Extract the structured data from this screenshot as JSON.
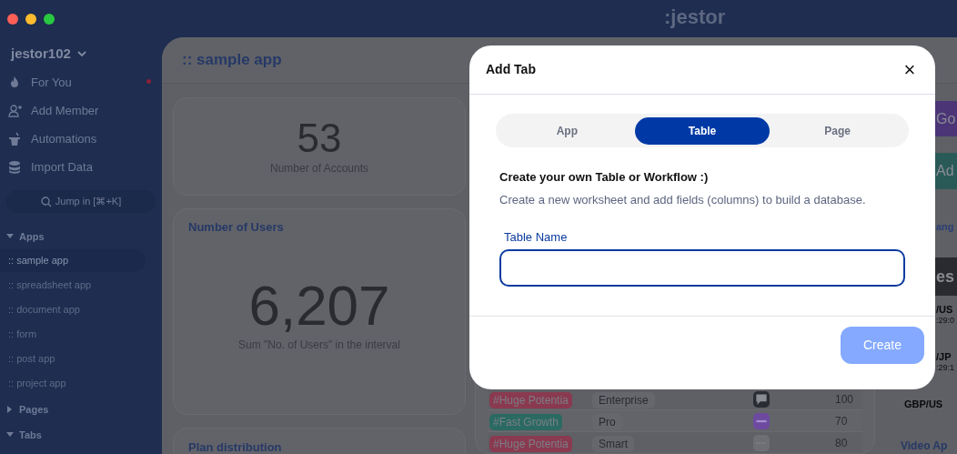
{
  "window": {
    "logo": ":jestor"
  },
  "sidebar": {
    "workspace": "jestor102",
    "items": [
      {
        "label": "For You",
        "notification": true
      },
      {
        "label": "Add Member",
        "notification": false
      },
      {
        "label": "Automations",
        "notification": false
      },
      {
        "label": "Import Data",
        "notification": false
      }
    ],
    "search": {
      "placeholder": "Jump in [⌘+K]"
    },
    "sections": [
      {
        "label": "Apps",
        "expanded": true,
        "items": [
          {
            "label": ":: sample app",
            "selected": true
          },
          {
            "label": ":: spreadsheet app",
            "selected": false
          },
          {
            "label": ":: document app",
            "selected": false
          },
          {
            "label": ":: form",
            "selected": false
          },
          {
            "label": ":: post app",
            "selected": false
          },
          {
            "label": ":: project app",
            "selected": false
          }
        ]
      },
      {
        "label": "Pages",
        "expanded": false
      },
      {
        "label": "Tabs",
        "expanded": true
      }
    ]
  },
  "main": {
    "title": ":: sample app",
    "accounts_card": {
      "value": "53",
      "label": "Number of Accounts"
    },
    "users_card": {
      "title": "Number of Users",
      "value": "6,207",
      "label": "Sum \"No. of Users\" in the interval"
    },
    "plan_card": {
      "title": "Plan distribution"
    },
    "table": {
      "rows": [
        {
          "tag": "#Huge Potentia",
          "color": "#8a3a50",
          "plan": "Enterprise",
          "value": "100"
        },
        {
          "tag": "#Fast Growth",
          "color": "#2a6a62",
          "plan": "Pro",
          "value": "70"
        },
        {
          "tag": "#Huge Potentia",
          "color": "#8a3a50",
          "plan": "Smart",
          "value": "80"
        }
      ]
    },
    "right_column": {
      "buttons": [
        {
          "label": "Go",
          "color": "#4b3577"
        },
        {
          "label": "Ad",
          "color": "#2a5a58"
        }
      ],
      "heading": "ang",
      "banner": "es",
      "rows": [
        {
          "pair": "/US",
          "time": ":29:0"
        },
        {
          "pair": "/JP",
          "time": ":29:1"
        }
      ],
      "last_pair": "GBP/US",
      "card_title": "Video Ap"
    }
  },
  "modal": {
    "title": "Add Tab",
    "close": "×",
    "tabs": [
      {
        "label": "App",
        "selected": false
      },
      {
        "label": "Table",
        "selected": true
      },
      {
        "label": "Page",
        "selected": false
      }
    ],
    "heading": "Create your own Table or Workflow :)",
    "description": "Create a new worksheet and add fields (columns) to build a database.",
    "field": {
      "label": "Table Name"
    },
    "button": {
      "label": "Create",
      "disabled": true
    }
  }
}
